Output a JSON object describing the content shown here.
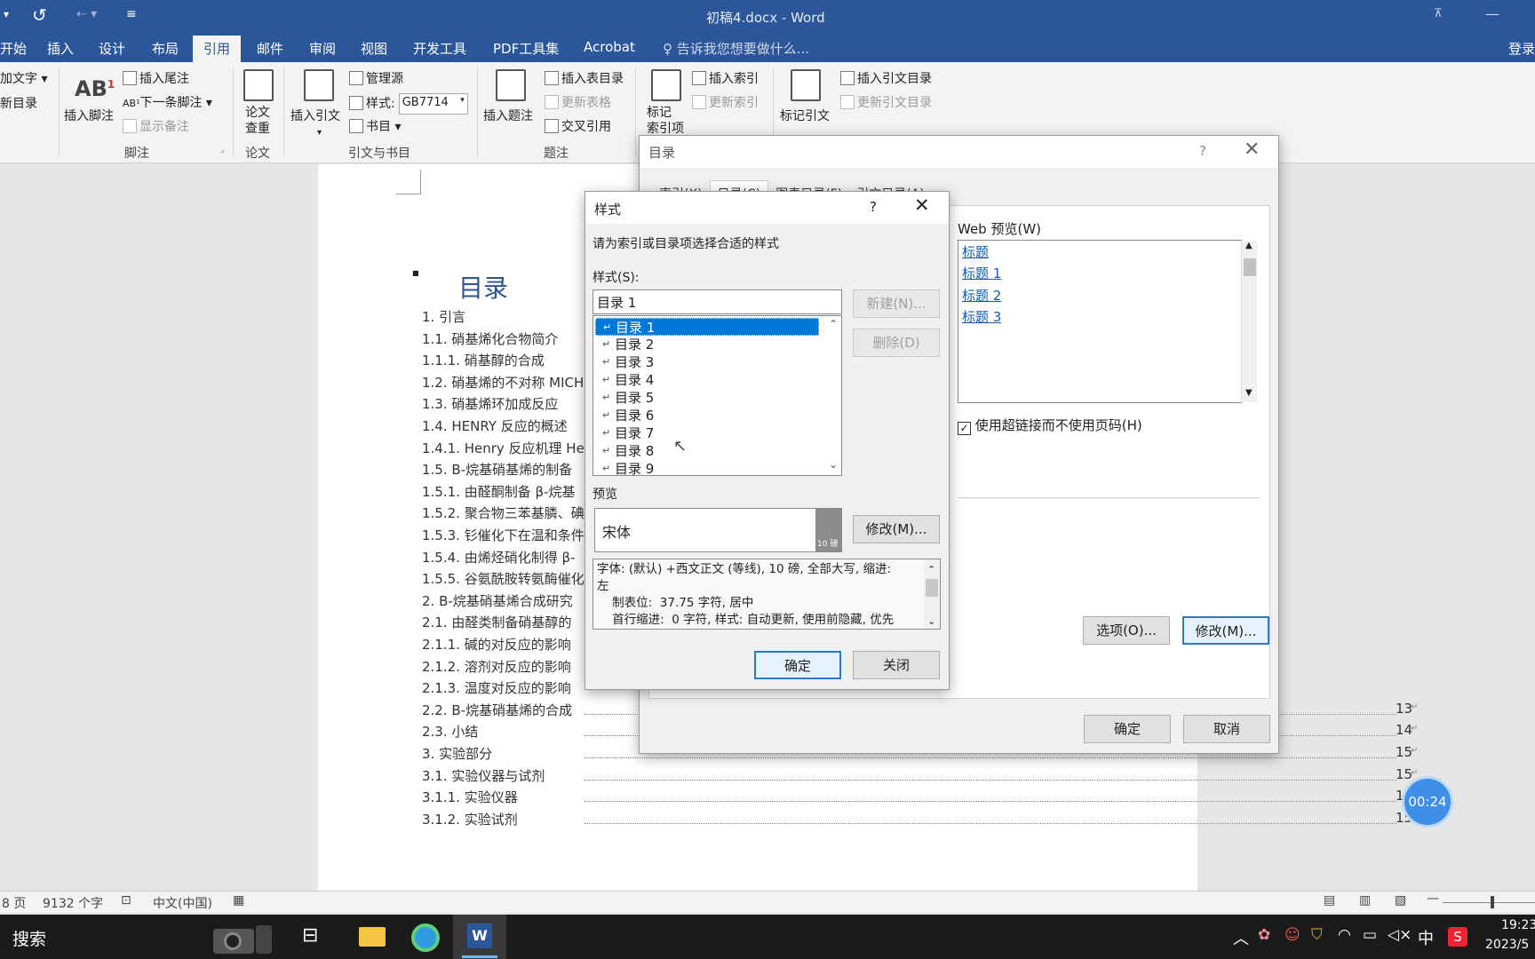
{
  "window": {
    "title": "初稿4.docx - Word",
    "signin": "登录"
  },
  "ribbon_tabs": [
    "开始",
    "插入",
    "设计",
    "布局",
    "引用",
    "邮件",
    "审阅",
    "视图",
    "开发工具",
    "PDF工具集",
    "Acrobat"
  ],
  "active_tab": "引用",
  "tell_me": "告诉我您想要做什么...",
  "ribbon": {
    "add_text": "加文字",
    "update_toc": "新目录",
    "insert_footnote": "插入脚注",
    "insert_endnote": "插入尾注",
    "next_footnote": "下一条脚注",
    "show_notes": "显示备注",
    "group_footnotes": "脚注",
    "paper_check": "论文\n查重",
    "group_paper": "论文",
    "insert_citation": "插入引文",
    "manage_sources": "管理源",
    "style_label": "样式:",
    "style_value": "GB7714",
    "bibliography": "书目",
    "group_citations": "引文与书目",
    "insert_caption": "插入题注",
    "insert_table_of_figures": "插入表目录",
    "update_table": "更新表格",
    "cross_reference": "交叉引用",
    "group_captions": "题注",
    "mark_entry": "标记\n索引项",
    "insert_index": "插入索引",
    "update_index": "更新索引",
    "mark_citation": "标记引文",
    "insert_toa": "插入引文目录",
    "update_toa": "更新引文目录"
  },
  "document": {
    "heading": "目录",
    "toc": [
      {
        "text": "1.  引言",
        "page": ""
      },
      {
        "text": "1.1.  硝基烯化合物简介",
        "page": ""
      },
      {
        "text": "1.1.1.  硝基醇的合成",
        "page": ""
      },
      {
        "text": "1.2.  硝基烯的不对称 MICH",
        "page": ""
      },
      {
        "text": "1.3.  硝基烯环加成反应",
        "page": ""
      },
      {
        "text": "1.4. HENRY 反应的概述",
        "page": ""
      },
      {
        "text": "1.4.1. Henry 反应机理 Her",
        "page": ""
      },
      {
        "text": "1.5.  Β-烷基硝基烯的制备",
        "page": ""
      },
      {
        "text": "1.5.1.  由醛酮制备 β-烷基",
        "page": ""
      },
      {
        "text": "1.5.2.  聚合物三苯基膦、碘",
        "page": ""
      },
      {
        "text": "1.5.3.  钐催化下在温和条件",
        "page": ""
      },
      {
        "text": "1.5.4.  由烯烃硝化制得 β-",
        "page": ""
      },
      {
        "text": "1.5.5.  谷氨酰胺转氨酶催化",
        "page": ""
      },
      {
        "text": "2. Β-烷基硝基烯合成研究",
        "page": ""
      },
      {
        "text": "2.1.  由醛类制备硝基醇的",
        "page": ""
      },
      {
        "text": "2.1.1.  碱的对反应的影响",
        "page": ""
      },
      {
        "text": "2.1.2.  溶剂对反应的影响",
        "page": ""
      },
      {
        "text": "2.1.3.  温度对反应的影响",
        "page": ""
      },
      {
        "text": "2.2. Β-烷基硝基烯的合成",
        "page": "13"
      },
      {
        "text": "2.3.  小结",
        "page": "14"
      },
      {
        "text": "3.  实验部分",
        "page": "15"
      },
      {
        "text": "3.1.  实验仪器与试剂",
        "page": "15"
      },
      {
        "text": "3.1.1.  实验仪器",
        "page": "15"
      },
      {
        "text": "3.1.2.  实验试剂",
        "page": "15"
      }
    ]
  },
  "status": {
    "page": "8 页",
    "words": "9132 个字",
    "language": "中文(中国)"
  },
  "taskbar": {
    "search": "搜索",
    "ime": "中",
    "time": "19:23",
    "date": "2023/5"
  },
  "timer": "00:24",
  "toc_dialog": {
    "title": "目录",
    "help": "?",
    "tabs": [
      "索引(X)",
      "目录(C)",
      "图表目录(F)",
      "引文目录(A)"
    ],
    "web_preview_label": "Web 预览(W)",
    "web_preview_items": [
      "标题",
      "标题 1",
      "标题 2",
      "标题 3"
    ],
    "use_hyperlinks": "使用超链接而不使用页码(H)",
    "use_hyperlinks_checked": true,
    "options_button": "选项(O)...",
    "modify_button": "修改(M)...",
    "ok": "确定",
    "cancel": "取消"
  },
  "style_dialog": {
    "title": "样式",
    "help": "?",
    "instruction": "请为索引或目录项选择合适的样式",
    "styles_label": "样式(S):",
    "style_input": "目录 1",
    "styles": [
      "目录 1",
      "目录 2",
      "目录 3",
      "目录 4",
      "目录 5",
      "目录 6",
      "目录 7",
      "目录 8",
      "目录 9"
    ],
    "selected_index": 0,
    "new_button": "新建(N)...",
    "delete_button": "删除(D)",
    "preview_label": "预览",
    "preview_font": "宋体",
    "preview_size": "10 磅",
    "modify_button": "修改(M)...",
    "description_lines": [
      "字体: (默认) +西文正文 (等线), 10 磅, 全部大写, 缩进:",
      "左",
      "    制表位:  37.75 字符, 居中",
      "    首行缩进:  0 字符, 样式: 自动更新, 使用前隐藏, 优先"
    ],
    "ok": "确定",
    "close": "关闭"
  }
}
